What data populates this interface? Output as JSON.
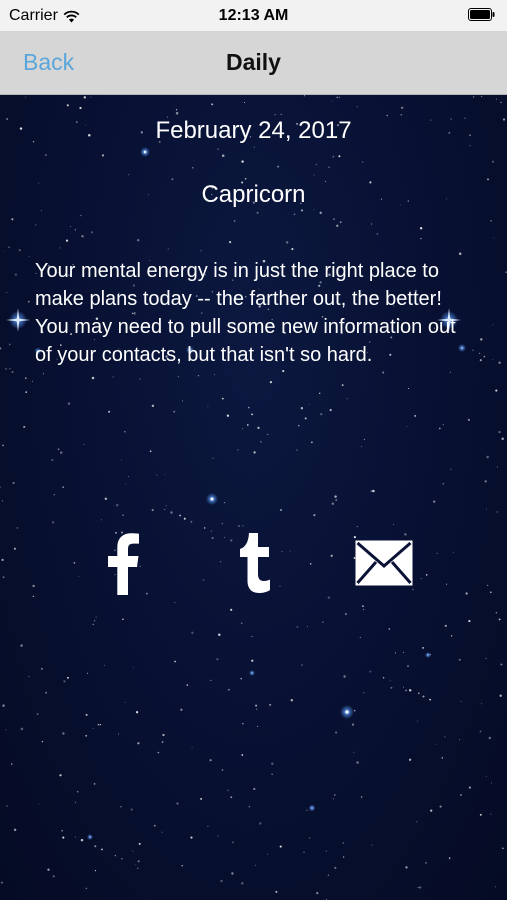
{
  "status_bar": {
    "carrier": "Carrier",
    "time": "12:13 AM"
  },
  "nav": {
    "back_label": "Back",
    "title": "Daily"
  },
  "horoscope": {
    "date": "February 24, 2017",
    "sign": "Capricorn",
    "text": "Your mental energy is in just the right place to make plans today -- the farther out, the better! You may need to pull some new information out of your contacts, but that isn't so hard."
  },
  "share": {
    "icons": [
      "facebook-icon",
      "tumblr-icon",
      "mail-icon"
    ]
  },
  "colors": {
    "back_link": "#5aa6da",
    "nav_background": "#d6d6d6",
    "status_background": "#f2f2f2",
    "sky": "#071031"
  }
}
